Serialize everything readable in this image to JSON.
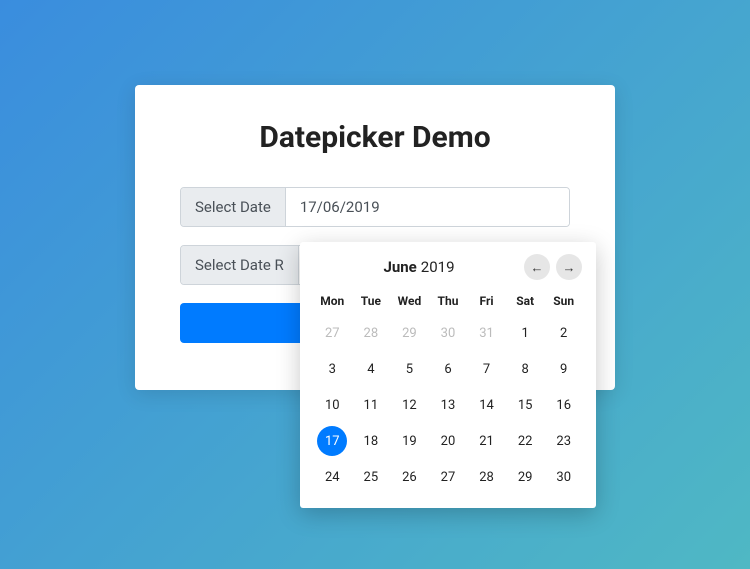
{
  "page": {
    "title": "Datepicker Demo"
  },
  "inputs": {
    "date_label": "Select Date",
    "date_value": "17/06/2019",
    "range_label": "Select Date R"
  },
  "calendar": {
    "month": "June",
    "year": "2019",
    "prev_arrow": "←",
    "next_arrow": "→",
    "dow": [
      "Mon",
      "Tue",
      "Wed",
      "Thu",
      "Fri",
      "Sat",
      "Sun"
    ],
    "weeks": [
      [
        {
          "d": "27",
          "other": true
        },
        {
          "d": "28",
          "other": true
        },
        {
          "d": "29",
          "other": true
        },
        {
          "d": "30",
          "other": true
        },
        {
          "d": "31",
          "other": true
        },
        {
          "d": "1"
        },
        {
          "d": "2"
        }
      ],
      [
        {
          "d": "3"
        },
        {
          "d": "4"
        },
        {
          "d": "5"
        },
        {
          "d": "6"
        },
        {
          "d": "7"
        },
        {
          "d": "8"
        },
        {
          "d": "9"
        }
      ],
      [
        {
          "d": "10"
        },
        {
          "d": "11"
        },
        {
          "d": "12"
        },
        {
          "d": "13"
        },
        {
          "d": "14"
        },
        {
          "d": "15"
        },
        {
          "d": "16"
        }
      ],
      [
        {
          "d": "17",
          "selected": true
        },
        {
          "d": "18"
        },
        {
          "d": "19"
        },
        {
          "d": "20"
        },
        {
          "d": "21"
        },
        {
          "d": "22"
        },
        {
          "d": "23"
        }
      ],
      [
        {
          "d": "24"
        },
        {
          "d": "25"
        },
        {
          "d": "26"
        },
        {
          "d": "27"
        },
        {
          "d": "28"
        },
        {
          "d": "29"
        },
        {
          "d": "30"
        }
      ]
    ]
  }
}
